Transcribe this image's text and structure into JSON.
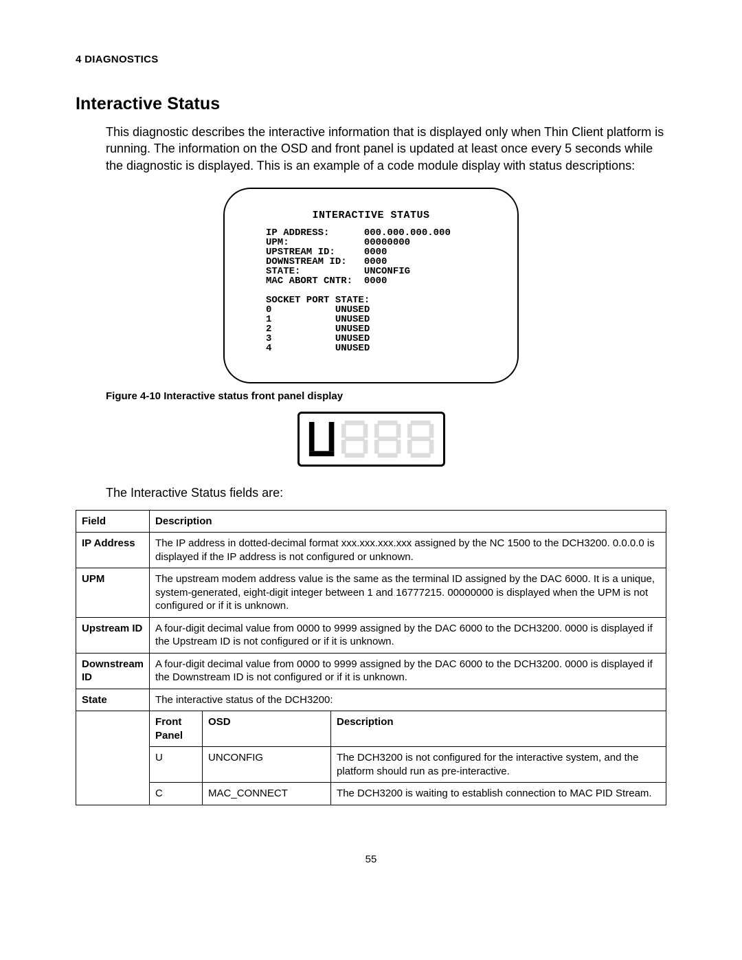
{
  "header": {
    "section": "4 DIAGNOSTICS"
  },
  "title": "Interactive Status",
  "intro": "This diagnostic describes the interactive information that is displayed only when Thin Client platform is running. The information on the OSD and front panel is updated at least once every 5 seconds while the diagnostic is displayed. This is an example of a code module display with status descriptions:",
  "osd": {
    "title": "INTERACTIVE STATUS",
    "rows": [
      {
        "label": "IP ADDRESS:",
        "value": "000.000.000.000"
      },
      {
        "label": "UPM:",
        "value": "00000000"
      },
      {
        "label": "UPSTREAM ID:",
        "value": "0000"
      },
      {
        "label": "DOWNSTREAM ID:",
        "value": "0000"
      },
      {
        "label": "STATE:",
        "value": "UNCONFIG"
      },
      {
        "label": "MAC ABORT CNTR:",
        "value": "0000"
      }
    ],
    "socket_header": "SOCKET PORT STATE:",
    "sockets": [
      {
        "port": "0",
        "state": "UNUSED"
      },
      {
        "port": "1",
        "state": "UNUSED"
      },
      {
        "port": "2",
        "state": "UNUSED"
      },
      {
        "port": "3",
        "state": "UNUSED"
      },
      {
        "port": "4",
        "state": "UNUSED"
      }
    ]
  },
  "figure_caption": "Figure 4-10 Interactive status front panel display",
  "front_panel_value": "U",
  "fields_intro": "The Interactive Status fields are:",
  "table": {
    "headers": {
      "field": "Field",
      "description": "Description"
    },
    "rows": [
      {
        "field": "IP Address",
        "description": "The IP address in dotted-decimal format xxx.xxx.xxx.xxx assigned by the NC 1500 to the DCH3200. 0.0.0.0 is displayed if the IP address is not configured or unknown."
      },
      {
        "field": "UPM",
        "description": "The upstream modem address value is the same as the terminal ID assigned by the DAC 6000. It is a unique, system-generated, eight-digit integer between 1 and 16777215. 00000000 is displayed when the UPM is not configured or if it is unknown."
      },
      {
        "field": "Upstream ID",
        "description": "A four-digit decimal value from 0000 to 9999 assigned by the DAC 6000 to the DCH3200. 0000 is displayed if the Upstream ID is not configured or if it is unknown."
      },
      {
        "field": "Downstream ID",
        "description": "A four-digit decimal value from 0000 to 9999 assigned by the DAC 6000 to the DCH3200. 0000 is displayed if the Downstream ID is not configured or if it is unknown."
      },
      {
        "field": "State",
        "description": "The interactive status of the DCH3200:"
      }
    ],
    "state_sub": {
      "headers": {
        "front_panel": "Front Panel",
        "osd": "OSD",
        "description": "Description"
      },
      "rows": [
        {
          "front_panel": "U",
          "osd": "UNCONFIG",
          "description": "The DCH3200 is not configured for the interactive system, and the platform should run as pre-interactive."
        },
        {
          "front_panel": "C",
          "osd": "MAC_CONNECT",
          "description": "The DCH3200 is waiting to establish connection to MAC PID Stream."
        }
      ]
    }
  },
  "page_number": "55"
}
